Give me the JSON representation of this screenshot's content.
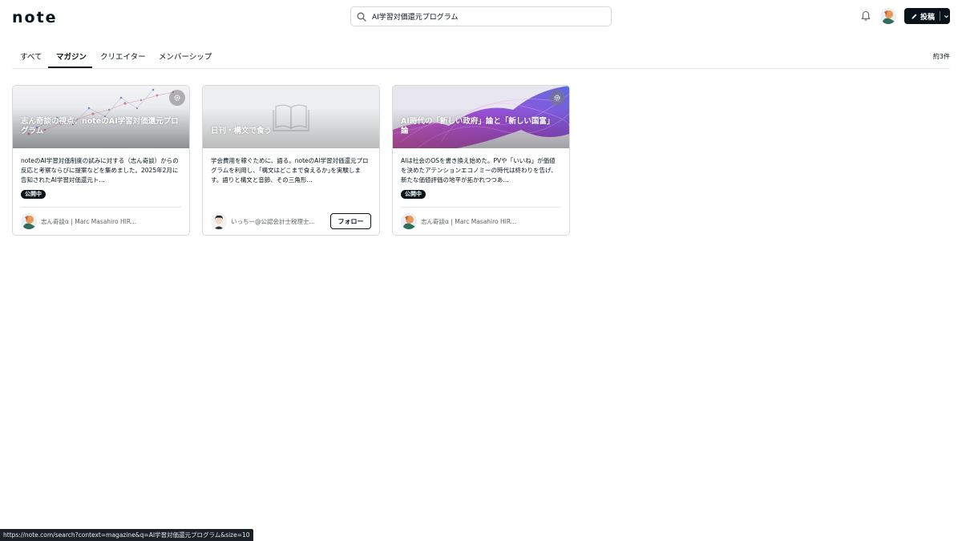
{
  "header": {
    "logo": "note",
    "search_value": "AI学習対価還元プログラム",
    "post_label": "投稿"
  },
  "tabs": [
    {
      "label": "すべて",
      "active": false
    },
    {
      "label": "マガジン",
      "active": true
    },
    {
      "label": "クリエイター",
      "active": false
    },
    {
      "label": "メンバーシップ",
      "active": false
    }
  ],
  "result_count": "約3件",
  "cards": [
    {
      "title": "志ん奇談の視点：noteのAI学習対価還元プログラム",
      "description": "noteのAI学習対価制度の試みに対する（志ん奇談）からの反応と考察ならびに提案などを集めました。2025年2月に告知されたAI学習対価還元ト…",
      "badge": "公開中",
      "author": "志ん奇談α | Marc Masahiro HIRA…"
    },
    {
      "title": "日刊・構文で食う",
      "description": "学会費用を稼ぐために、語る。noteのAI学習対価還元プログラムを利用し、｢構文はどこまで食えるか｣を実験します。語りと構文と音節、その三角形…",
      "author": "いっちー@公認会計士税理士・…",
      "follow_label": "フォロー"
    },
    {
      "title": "AI時代の「新しい政府」論と「新しい国富」論",
      "description": "AIは社会のOSを書き換え始めた。PVや「いいね」が価値を決めたアテンションエコノミーの時代は終わりを告げ、新たな価値評価の地平が拓かれつつあ…",
      "badge": "公開中",
      "author": "志ん奇談α | Marc Masahiro HIRA…"
    }
  ],
  "status_url": "https://note.com/search?context=magazine&q=AI学習対価還元プログラム&size=10",
  "colors": {
    "primary": "#08131a",
    "border": "#d6d9dc"
  }
}
